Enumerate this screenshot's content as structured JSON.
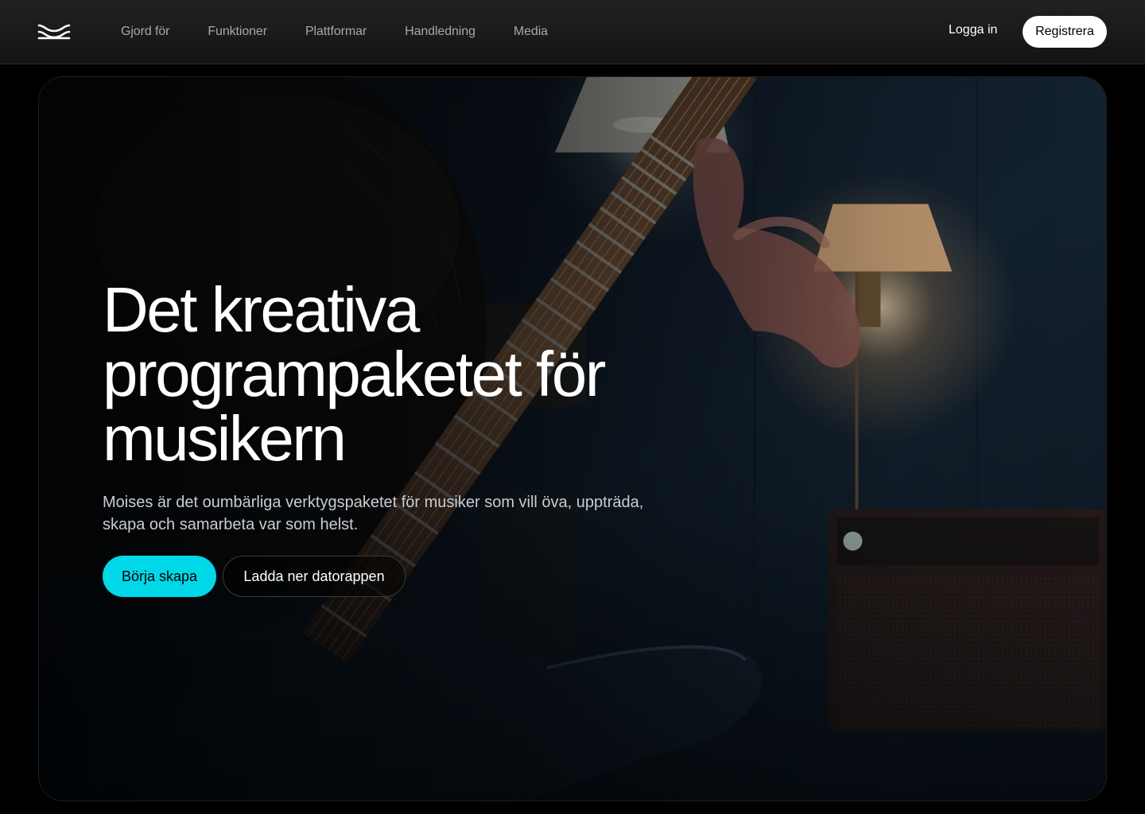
{
  "header": {
    "logo_icon": "moises-wave-logo",
    "nav": [
      {
        "label": "Gjord för"
      },
      {
        "label": "Funktioner"
      },
      {
        "label": "Plattformar"
      },
      {
        "label": "Handledning"
      },
      {
        "label": "Media"
      }
    ],
    "login_label": "Logga in",
    "signup_label": "Registrera"
  },
  "hero": {
    "title": "Det kreativa programpaketet för musikern",
    "subtitle": "Moises är det oumbärliga verktygspaketet för musiker som vill öva, uppträda, skapa och samarbeta var som helst.",
    "primary_cta": "Börja skapa",
    "secondary_cta": "Ladda ner datorappen",
    "background_image": "guitarist-playing-electric-guitar-photo"
  },
  "colors": {
    "accent": "#00d8e8",
    "background": "#000000",
    "nav_text": "#a8a8a8",
    "button_light": "#ffffff"
  }
}
